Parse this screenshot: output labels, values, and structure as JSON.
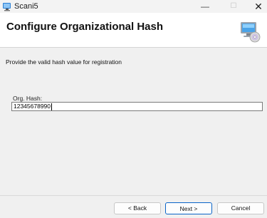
{
  "window": {
    "title": "Scani5",
    "min_glyph": "—",
    "max_glyph": "☐",
    "close_glyph": "✕"
  },
  "header": {
    "title": "Configure Organizational Hash",
    "icon": "computer-cd-icon"
  },
  "main": {
    "description": "Provide the valid hash value for registration",
    "hash_label": "Org. Hash:",
    "hash_value": "12345678990"
  },
  "footer": {
    "back_label": "< Back",
    "next_label": "Next >",
    "cancel_label": "Cancel"
  },
  "colors": {
    "accent": "#0a64c8",
    "header_bg": "#ffffff",
    "body_bg": "#f0f0f0"
  }
}
